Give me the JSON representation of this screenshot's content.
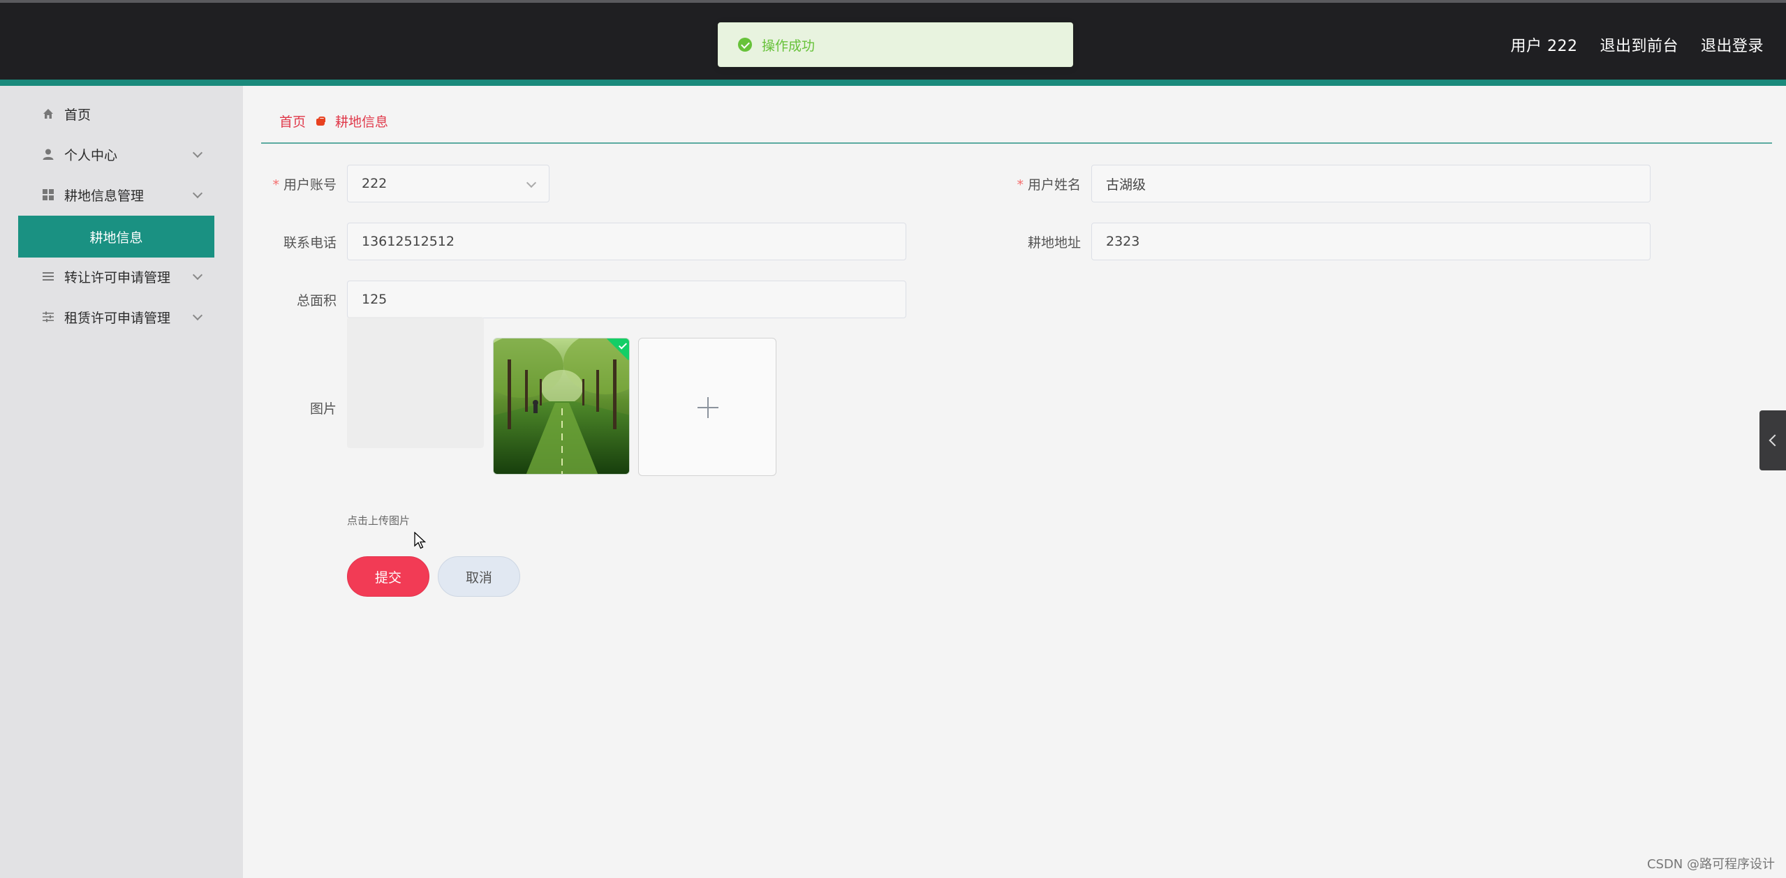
{
  "header": {
    "user_label": "用户 222",
    "goto_front_label": "退出到前台",
    "logout_label": "退出登录"
  },
  "toast": {
    "message": "操作成功",
    "icon": "check-circle-icon",
    "color": "#67c23a"
  },
  "sidebar": {
    "items": [
      {
        "label": "首页",
        "icon": "home-icon"
      },
      {
        "label": "个人中心",
        "icon": "user-icon",
        "expandable": true
      },
      {
        "label": "耕地信息管理",
        "icon": "grid-icon",
        "expandable": true,
        "expanded": true
      },
      {
        "label": "转让许可申请管理",
        "icon": "list-icon",
        "expandable": true
      },
      {
        "label": "租赁许可申请管理",
        "icon": "sliders-icon",
        "expandable": true
      }
    ],
    "active_sub_item": "耕地信息"
  },
  "breadcrumb": {
    "home": "首页",
    "current": "耕地信息"
  },
  "form": {
    "account": {
      "label": "用户账号",
      "value": "222",
      "required": true
    },
    "name": {
      "label": "用户姓名",
      "value": "古湖级",
      "required": true
    },
    "phone": {
      "label": "联系电话",
      "value": "13612512512"
    },
    "address": {
      "label": "耕地地址",
      "value": "2323"
    },
    "area": {
      "label": "总面积",
      "value": "125"
    },
    "image": {
      "label": "图片",
      "tip": "点击上传图片"
    },
    "submit_label": "提交",
    "cancel_label": "取消"
  },
  "watermark": "CSDN @路可程序设计",
  "colors": {
    "accent": "#1a9182",
    "header_bg": "#1f1f22",
    "submit": "#f23b55",
    "breadcrumb": "#e0394a"
  }
}
